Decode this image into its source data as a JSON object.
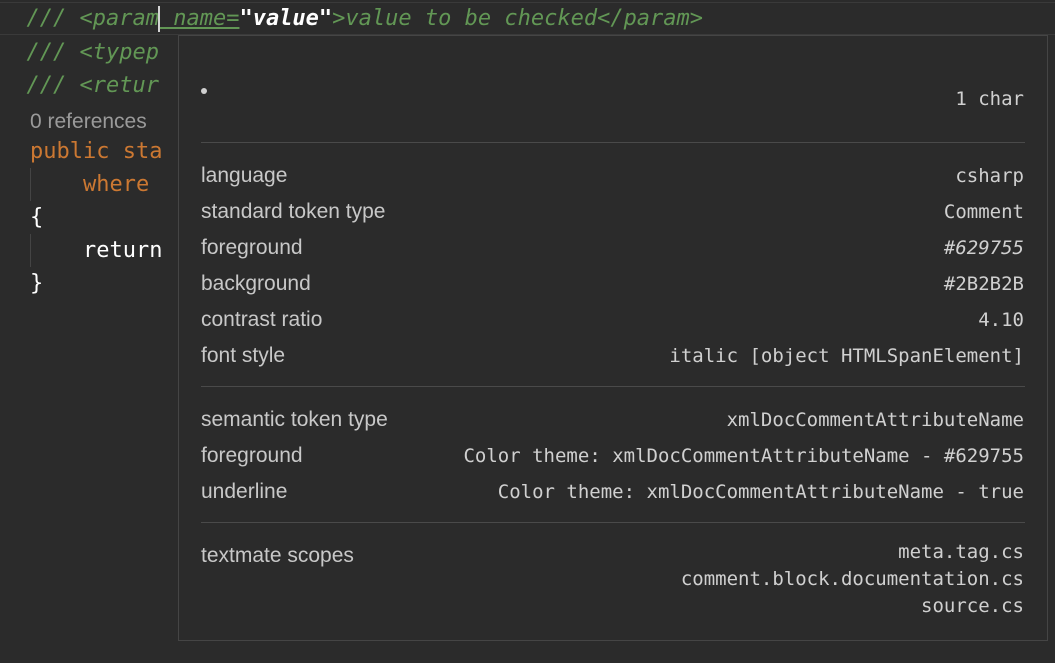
{
  "editor": {
    "line1": {
      "prefix": "///",
      "tag_open": " <param",
      "attr": " name=",
      "value": "\"value\"",
      "rest": ">value to be checked</param>"
    },
    "line2": {
      "prefix": "///",
      "text": " <typep"
    },
    "line3": {
      "prefix": "///",
      "text": " <retur"
    },
    "codelens": "0 references",
    "line4": {
      "kw1": "public",
      "kw2": " sta"
    },
    "line5": {
      "indent": "    ",
      "kw": "where"
    },
    "line6": {
      "text": "{"
    },
    "line7": {
      "indent": "    ",
      "text": "return"
    },
    "line8": {
      "text": "}"
    }
  },
  "hover": {
    "header_length": "1 char",
    "language": {
      "label": "language",
      "value": "csharp"
    },
    "standard_token_type": {
      "label": "standard token type",
      "value": "Comment"
    },
    "foreground": {
      "label": "foreground",
      "value": "#629755"
    },
    "background": {
      "label": "background",
      "value": "#2B2B2B"
    },
    "contrast_ratio": {
      "label": "contrast ratio",
      "value": "4.10"
    },
    "font_style": {
      "label": "font style",
      "value": "italic [object HTMLSpanElement]"
    },
    "semantic_token_type": {
      "label": "semantic token type",
      "value": "xmlDocCommentAttributeName"
    },
    "semantic_foreground": {
      "label": "foreground",
      "value": "Color theme: xmlDocCommentAttributeName - #629755"
    },
    "underline": {
      "label": "underline",
      "value": "Color theme: xmlDocCommentAttributeName - true"
    },
    "textmate_scopes": {
      "label": "textmate scopes",
      "values": [
        "meta.tag.cs",
        "comment.block.documentation.cs",
        "source.cs"
      ]
    }
  },
  "colors": {
    "editor_bg": "#2B2B2B",
    "doc_comment": "#629755",
    "keyword": "#CC7832",
    "text": "#FFFFFF"
  }
}
